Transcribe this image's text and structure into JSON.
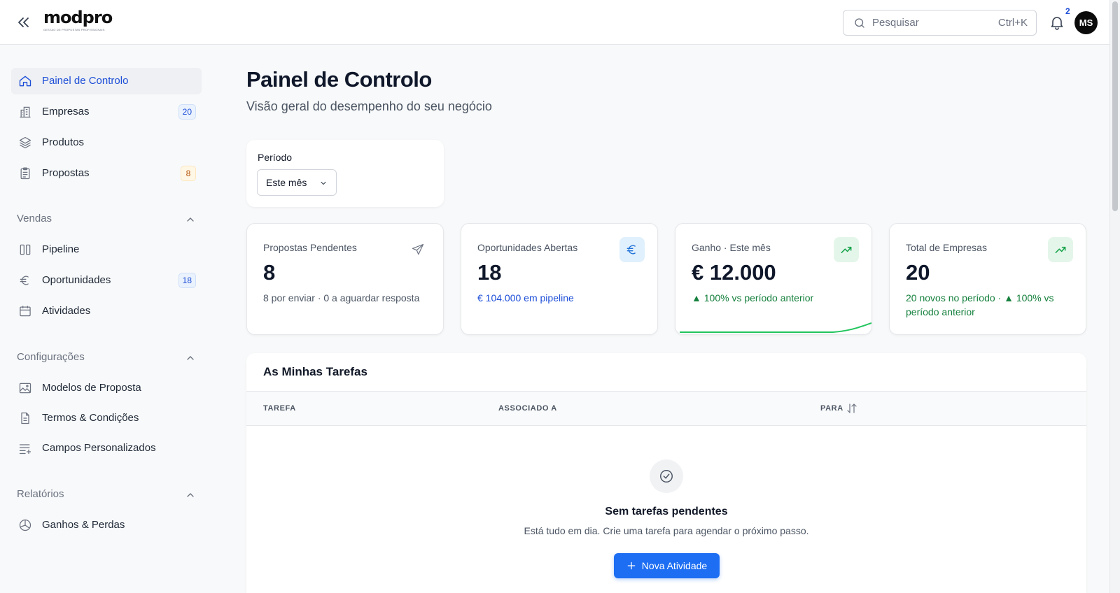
{
  "header": {
    "logo": {
      "word": "modpro",
      "tagline": "GESTAO DE PROPOSTAS PROFISSIONAIS"
    },
    "search": {
      "placeholder": "Pesquisar",
      "shortcut": "Ctrl+K"
    },
    "notifications": {
      "count": "2"
    },
    "avatar_initials": "MS"
  },
  "sidebar": {
    "main_items": [
      {
        "label": "Painel de Controlo",
        "icon": "home-icon",
        "active": true
      },
      {
        "label": "Empresas",
        "icon": "building-icon",
        "badge": "20"
      },
      {
        "label": "Produtos",
        "icon": "layers-icon"
      },
      {
        "label": "Propostas",
        "icon": "clipboard-icon",
        "badge": "8"
      }
    ],
    "sections": [
      {
        "label": "Vendas",
        "items": [
          {
            "label": "Pipeline",
            "icon": "columns-icon"
          },
          {
            "label": "Oportunidades",
            "icon": "euro-icon",
            "badge": "18"
          },
          {
            "label": "Atividades",
            "icon": "calendar-icon"
          }
        ]
      },
      {
        "label": "Configurações",
        "items": [
          {
            "label": "Modelos de Proposta",
            "icon": "image-icon"
          },
          {
            "label": "Termos & Condições",
            "icon": "document-icon"
          },
          {
            "label": "Campos Personalizados",
            "icon": "list-plus-icon"
          }
        ]
      },
      {
        "label": "Relatórios",
        "items": [
          {
            "label": "Ganhos & Perdas",
            "icon": "pie-chart-icon"
          }
        ]
      }
    ]
  },
  "main": {
    "title": "Painel de Controlo",
    "subtitle": "Visão geral do desempenho do seu negócio",
    "period": {
      "label": "Período",
      "value": "Este mês"
    },
    "stats": [
      {
        "title": "Propostas Pendentes",
        "value": "8",
        "note": "8 por enviar · 0 a aguardar resposta",
        "icon": "send-icon"
      },
      {
        "title": "Oportunidades Abertas",
        "value": "18",
        "note": "€ 104.000 em pipeline",
        "icon": "euro-icon"
      },
      {
        "title": "Ganho · Este mês",
        "value": "€ 12.000",
        "note": "▲ 100% vs período anterior",
        "icon": "trending-up-icon"
      },
      {
        "title": "Total de Empresas",
        "value": "20",
        "note": "20 novos no período · ▲ 100% vs período anterior",
        "icon": "trending-up-icon"
      }
    ],
    "tasks": {
      "title": "As Minhas Tarefas",
      "columns": [
        "TAREFA",
        "ASSOCIADO A",
        "PARA"
      ],
      "empty_title": "Sem tarefas pendentes",
      "empty_desc": "Está tudo em dia. Crie uma tarefa para agendar o próximo passo.",
      "new_button": "Nova Atividade"
    }
  },
  "colors": {
    "accent": "#1d6ef2",
    "active_nav": "#1d4ed8",
    "positive": "#15803d"
  }
}
